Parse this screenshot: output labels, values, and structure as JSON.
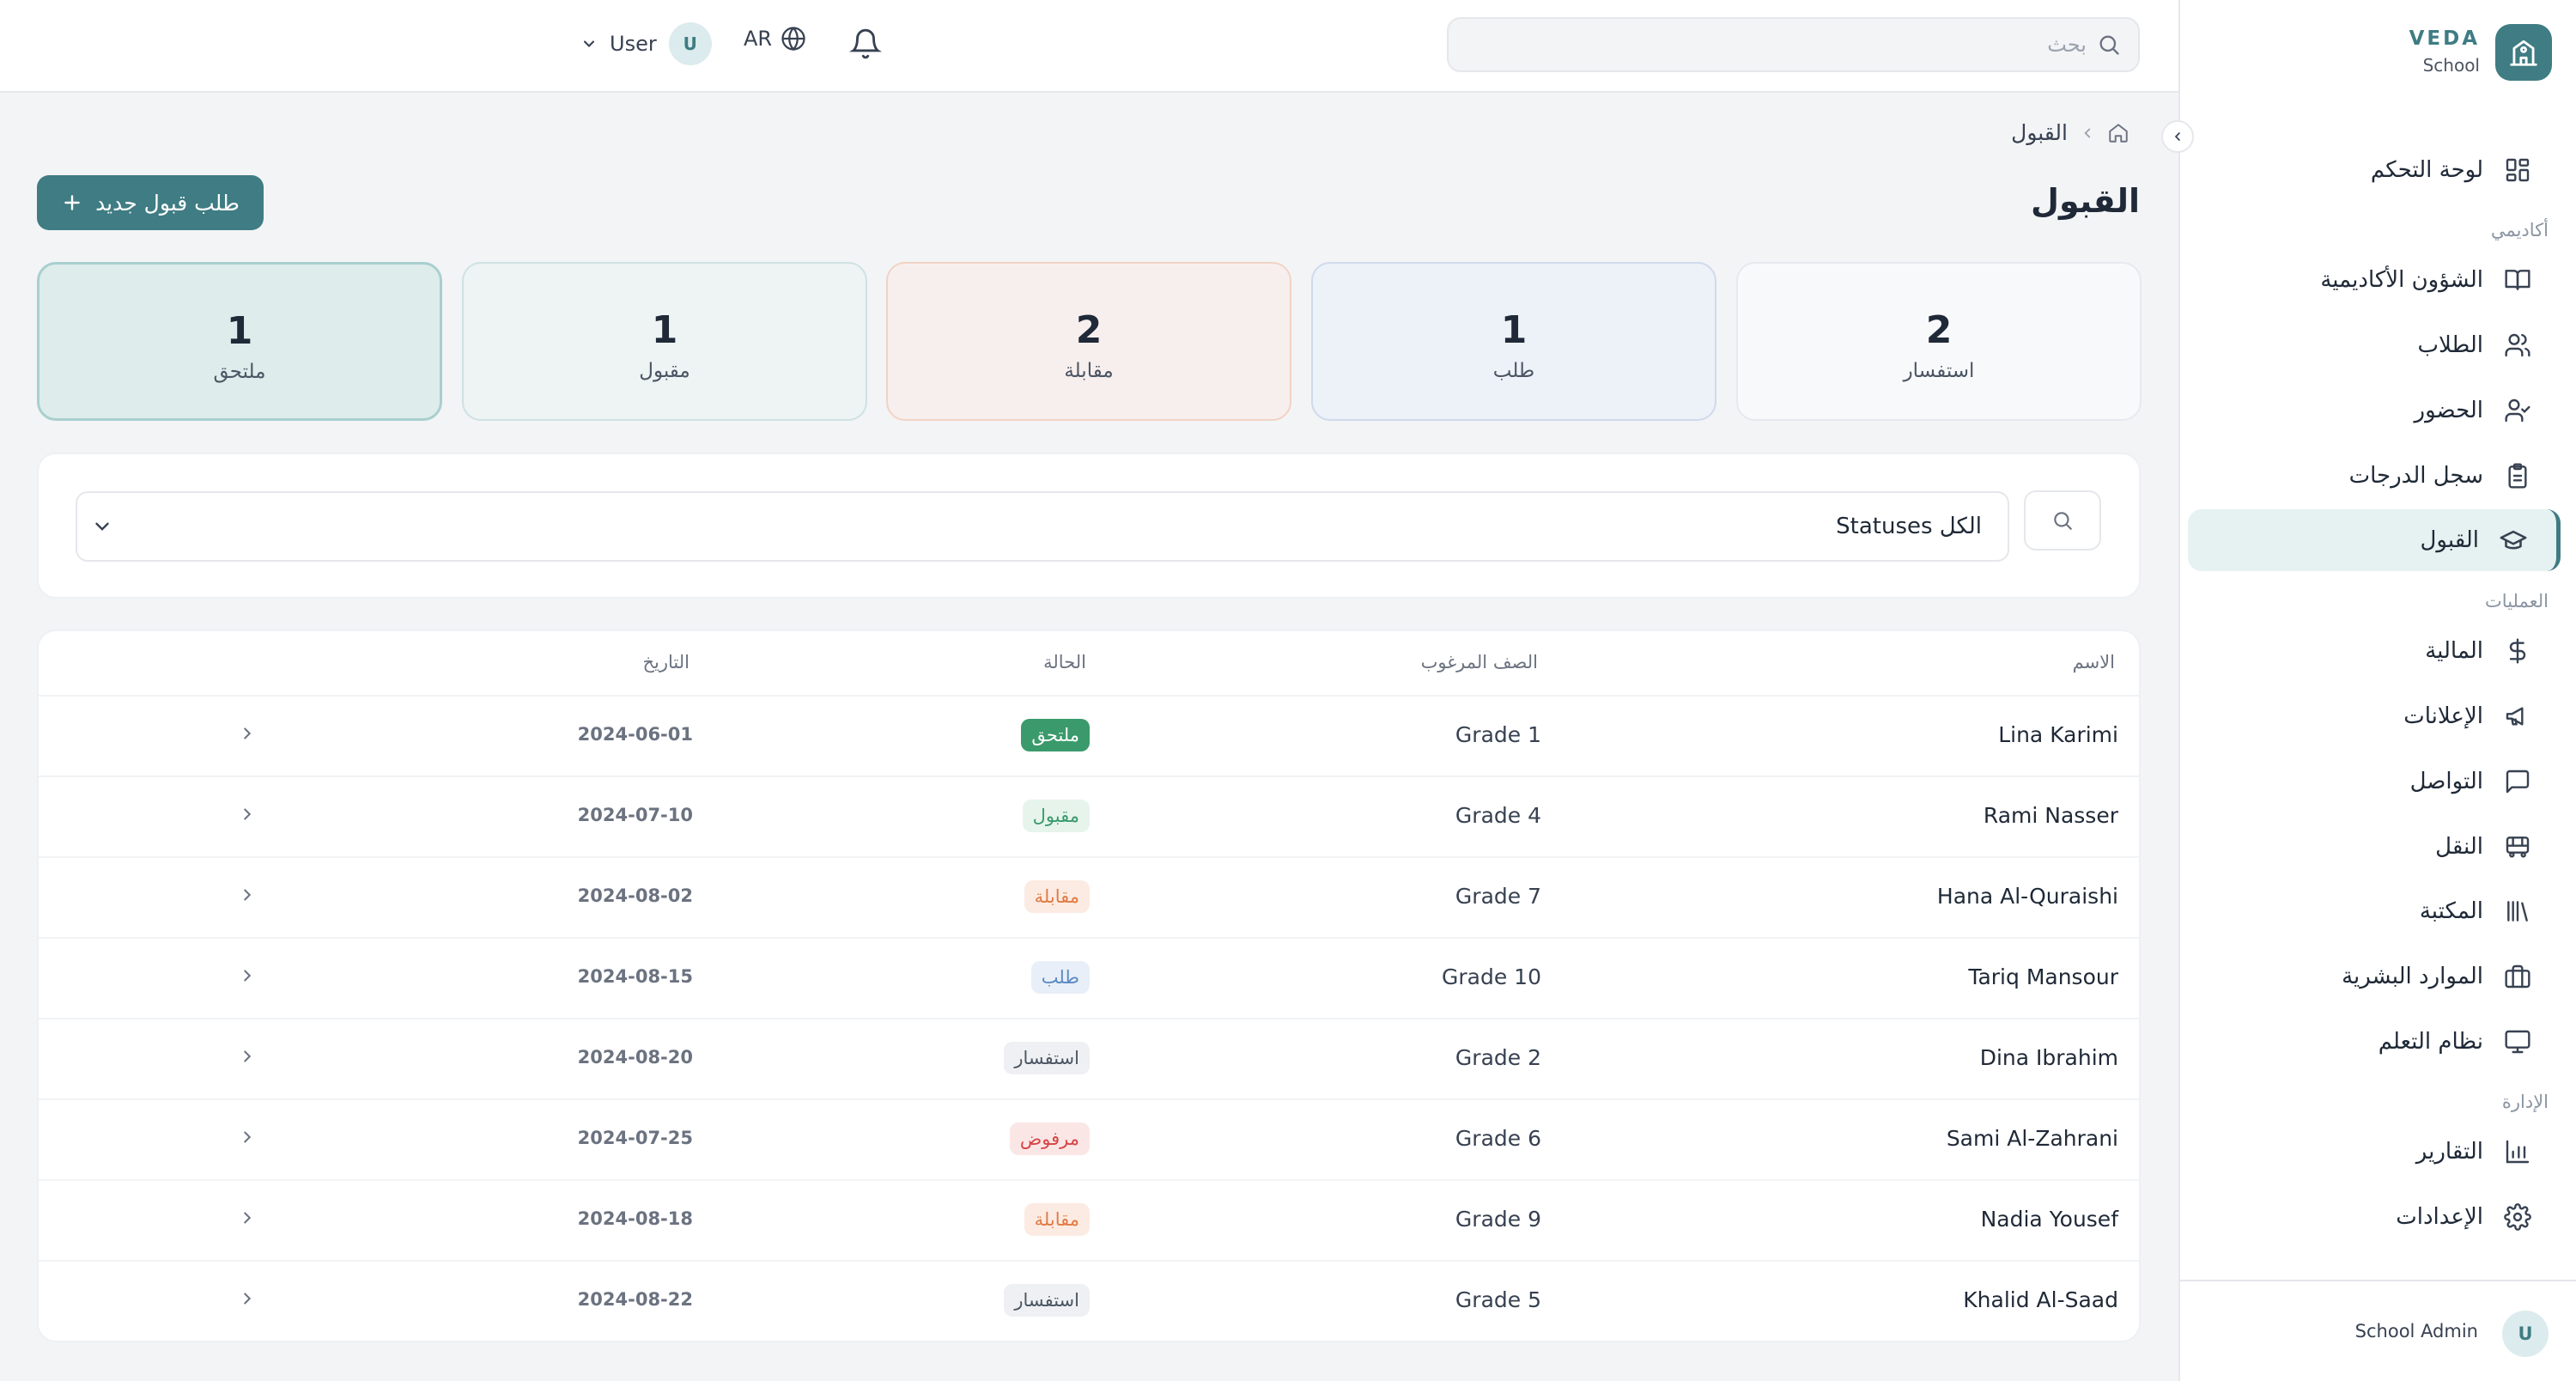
{
  "brand": {
    "name": "VEDA",
    "sub": "School"
  },
  "header": {
    "search_placeholder": "بحث",
    "lang": "AR",
    "user_initial": "U",
    "user_name": "User"
  },
  "sidebar": {
    "sections": {
      "academic": "أكاديمي",
      "operations": "العمليات",
      "admin": "الإدارة"
    },
    "items": [
      {
        "label": "لوحة التحكم",
        "icon": "dashboard-icon"
      },
      {
        "label": "الشؤون الأكاديمية",
        "icon": "book-icon"
      },
      {
        "label": "الطلاب",
        "icon": "users-icon"
      },
      {
        "label": "الحضور",
        "icon": "user-check-icon"
      },
      {
        "label": "سجل الدرجات",
        "icon": "clipboard-icon"
      },
      {
        "label": "القبول",
        "icon": "graduation-cap-icon"
      },
      {
        "label": "المالية",
        "icon": "dollar-icon"
      },
      {
        "label": "الإعلانات",
        "icon": "megaphone-icon"
      },
      {
        "label": "التواصل",
        "icon": "message-icon"
      },
      {
        "label": "النقل",
        "icon": "bus-icon"
      },
      {
        "label": "المكتبة",
        "icon": "library-icon"
      },
      {
        "label": "الموارد البشرية",
        "icon": "briefcase-icon"
      },
      {
        "label": "نظام التعلم",
        "icon": "monitor-icon"
      },
      {
        "label": "التقارير",
        "icon": "bar-chart-icon"
      },
      {
        "label": "الإعدادات",
        "icon": "gear-icon"
      }
    ],
    "footer": {
      "initial": "U",
      "name": "School Admin"
    }
  },
  "main": {
    "breadcrumb": "القبول",
    "title": "القبول",
    "new_button": "طلب قبول جديد",
    "stats": [
      {
        "value": "2",
        "label": "استفسار"
      },
      {
        "value": "1",
        "label": "طلب"
      },
      {
        "value": "2",
        "label": "مقابلة"
      },
      {
        "value": "1",
        "label": "مقبول"
      },
      {
        "value": "1",
        "label": "ملتحق"
      }
    ],
    "filter_value": "Statuses الكل",
    "columns": {
      "name": "الاسم",
      "grade": "الصف المرغوب",
      "status": "الحالة",
      "date": "التاريخ"
    },
    "rows": [
      {
        "name": "Lina Karimi",
        "grade": "Grade 1",
        "status": "ملتحق",
        "date": "2024-06-01"
      },
      {
        "name": "Rami Nasser",
        "grade": "Grade 4",
        "status": "مقبول",
        "date": "2024-07-10"
      },
      {
        "name": "Hana Al-Quraishi",
        "grade": "Grade 7",
        "status": "مقابلة",
        "date": "2024-08-02"
      },
      {
        "name": "Tariq Mansour",
        "grade": "Grade 10",
        "status": "طلب",
        "date": "2024-08-15"
      },
      {
        "name": "Dina Ibrahim",
        "grade": "Grade 2",
        "status": "استفسار",
        "date": "2024-08-20"
      },
      {
        "name": "Sami Al-Zahrani",
        "grade": "Grade 6",
        "status": "مرفوض",
        "date": "2024-07-25"
      },
      {
        "name": "Nadia Yousef",
        "grade": "Grade 9",
        "status": "مقابلة",
        "date": "2024-08-18"
      },
      {
        "name": "Khalid Al-Saad",
        "grade": "Grade 5",
        "status": "استفسار",
        "date": "2024-08-22"
      }
    ]
  },
  "colors": {
    "accent": "#3f7c83",
    "enrolled": "#3a9a6b",
    "accepted": "#3a9a6b",
    "interview": "#e07b45",
    "application": "#5b8ac4",
    "inquiry": "#6b7280",
    "rejected": "#d64545"
  }
}
